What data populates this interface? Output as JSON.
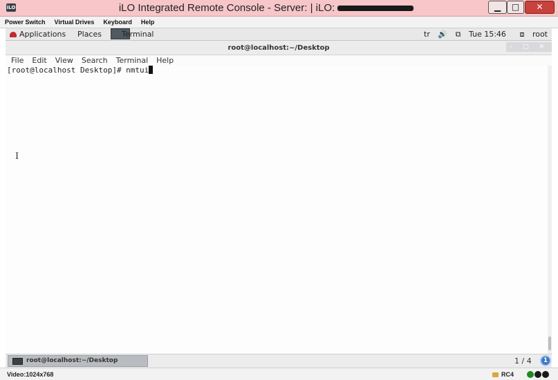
{
  "window": {
    "title": "iLO Integrated Remote Console - Server:  | iLO:",
    "app_icon_label": "iLO",
    "min_glyph": "▁",
    "max_glyph": "□",
    "close_glyph": "✕"
  },
  "ilo_menu": [
    "Power Switch",
    "Virtual Drives",
    "Keyboard",
    "Help"
  ],
  "gnome_panel": {
    "applications": "Applications",
    "places": "Places",
    "terminal": "Terminal",
    "input_method": "tr",
    "volume_glyph": "🔊",
    "network_glyph": "⧉",
    "clock": "Tue 15:46",
    "user": "root",
    "user_glyph": "⧈"
  },
  "terminal": {
    "title": "root@localhost:~/Desktop",
    "window_buttons": "– □ ✕",
    "menu": [
      "File",
      "Edit",
      "View",
      "Search",
      "Terminal",
      "Help"
    ],
    "prompt_line": "[root@localhost Desktop]# nmtui",
    "ibeam_glyph": "I"
  },
  "bottom_panel": {
    "task_label": "root@localhost:~/Desktop",
    "workspace": "1 / 4",
    "notification_count": "1"
  },
  "status_bar": {
    "video": "Video:1024x768",
    "encryption": "RC4"
  },
  "colors": {
    "status_dot_1": "#1e8a1e",
    "status_dot_2": "#1a1a1a",
    "status_dot_3": "#1a1a1a"
  }
}
